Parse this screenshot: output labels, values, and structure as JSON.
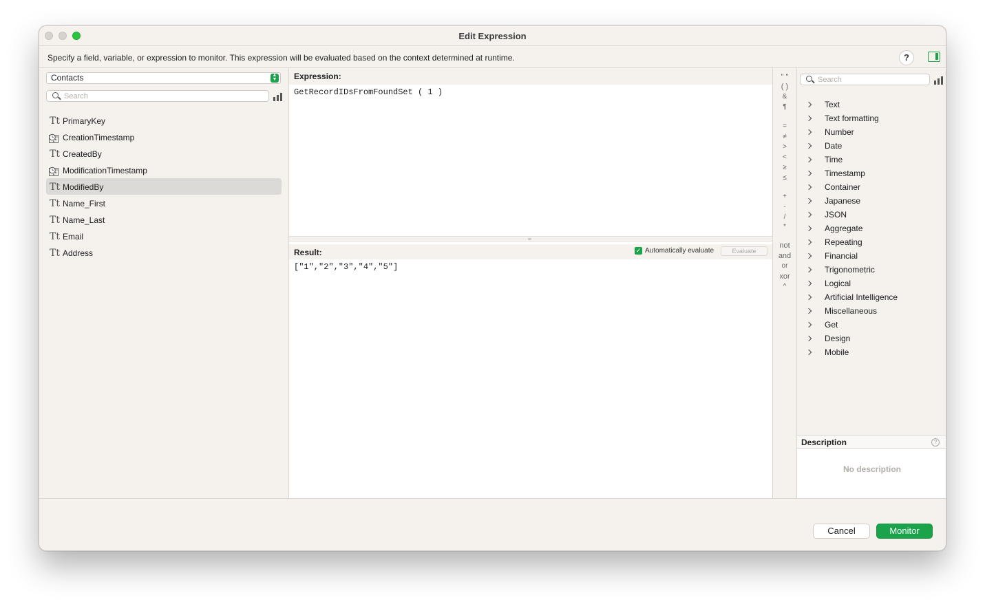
{
  "window": {
    "title": "Edit Expression"
  },
  "infobar": {
    "text": "Specify a field, variable, or expression to monitor. This expression will be evaluated based on the context determined at runtime.",
    "help_label": "?"
  },
  "fields_panel": {
    "table_select": "Contacts",
    "search_placeholder": "Search",
    "fields": [
      {
        "type": "text",
        "label": "PrimaryKey",
        "icon": "text-field-icon"
      },
      {
        "type": "timestamp",
        "label": "CreationTimestamp",
        "icon": "timestamp-field-icon"
      },
      {
        "type": "text",
        "label": "CreatedBy",
        "icon": "text-field-icon"
      },
      {
        "type": "timestamp",
        "label": "ModificationTimestamp",
        "icon": "timestamp-field-icon"
      },
      {
        "type": "text",
        "label": "ModifiedBy",
        "icon": "text-field-icon",
        "selected": true
      },
      {
        "type": "text",
        "label": "Name_First",
        "icon": "text-field-icon"
      },
      {
        "type": "text",
        "label": "Name_Last",
        "icon": "text-field-icon"
      },
      {
        "type": "text",
        "label": "Email",
        "icon": "text-field-icon"
      },
      {
        "type": "text",
        "label": "Address",
        "icon": "text-field-icon"
      }
    ],
    "text_type_glyph": "Tt"
  },
  "expression": {
    "label": "Expression:",
    "value": "GetRecordIDsFromFoundSet ( 1 )"
  },
  "result": {
    "label": "Result:",
    "auto_evaluate_label": "Automatically evaluate",
    "auto_evaluate_checked": true,
    "evaluate_button": "Evaluate",
    "value": "[\"1\",\"2\",\"3\",\"4\",\"5\"]"
  },
  "operators": [
    "\" \"",
    "( )",
    "&",
    "¶",
    "=",
    "≠",
    ">",
    "<",
    "≥",
    "≤",
    "+",
    "-",
    "/",
    "*",
    "not",
    "and",
    "or",
    "xor",
    "^"
  ],
  "functions_panel": {
    "search_placeholder": "Search",
    "categories": [
      "Text",
      "Text formatting",
      "Number",
      "Date",
      "Time",
      "Timestamp",
      "Container",
      "Japanese",
      "JSON",
      "Aggregate",
      "Repeating",
      "Financial",
      "Trigonometric",
      "Logical",
      "Artificial Intelligence",
      "Miscellaneous",
      "Get",
      "Design",
      "Mobile"
    ],
    "description_label": "Description",
    "description_help": "?",
    "no_description": "No description"
  },
  "buttons": {
    "cancel": "Cancel",
    "monitor": "Monitor"
  },
  "colors": {
    "accent": "#1aa34a",
    "window_bg": "#f5f1ed",
    "selected_row": "#dcdad8"
  }
}
